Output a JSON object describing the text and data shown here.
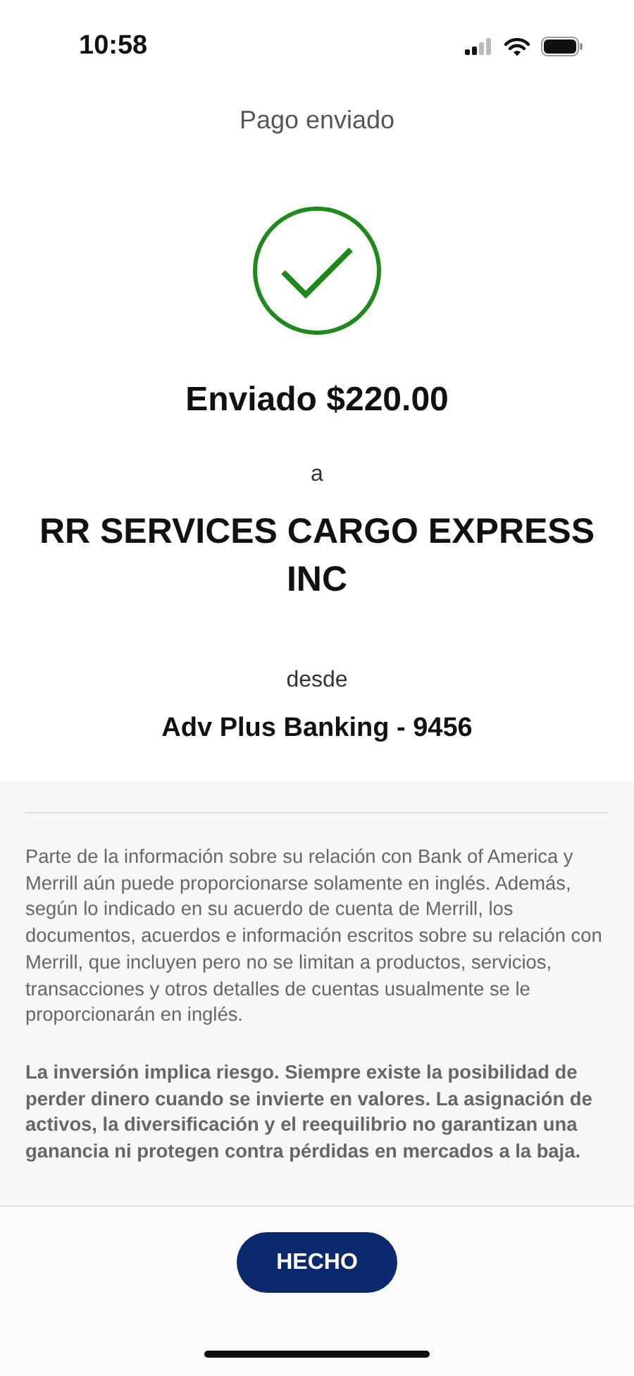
{
  "status_bar": {
    "time": "10:58"
  },
  "header": {
    "title": "Pago enviado"
  },
  "confirmation": {
    "succeeded": true,
    "amount_line": "Enviado $220.00",
    "to_word": "a",
    "recipient": "RR SERVICES CARGO EXPRESS INC",
    "from_word": "desde",
    "account": "Adv Plus Banking - 9456"
  },
  "disclosures": [
    {
      "text": "Parte de la información sobre su relación con Bank of America y Merrill aún puede proporcionarse solamente en inglés. Además, según lo indicado en su acuerdo de cuenta de Merrill, los documentos, acuerdos e información escritos sobre su relación con Merrill, que incluyen pero no se limitan a productos, servicios, transacciones y otros detalles de cuentas usualmente se le proporcionarán en inglés.",
      "bold": false
    },
    {
      "text": "La inversión implica riesgo. Siempre existe la posibilidad de perder dinero cuando se invierte en valores. La asignación de activos, la diversificación y el reequilibrio no garantizan una ganancia ni protegen contra pérdidas en mercados a la baja.",
      "bold": true
    }
  ],
  "footer": {
    "button": "HECHO"
  }
}
